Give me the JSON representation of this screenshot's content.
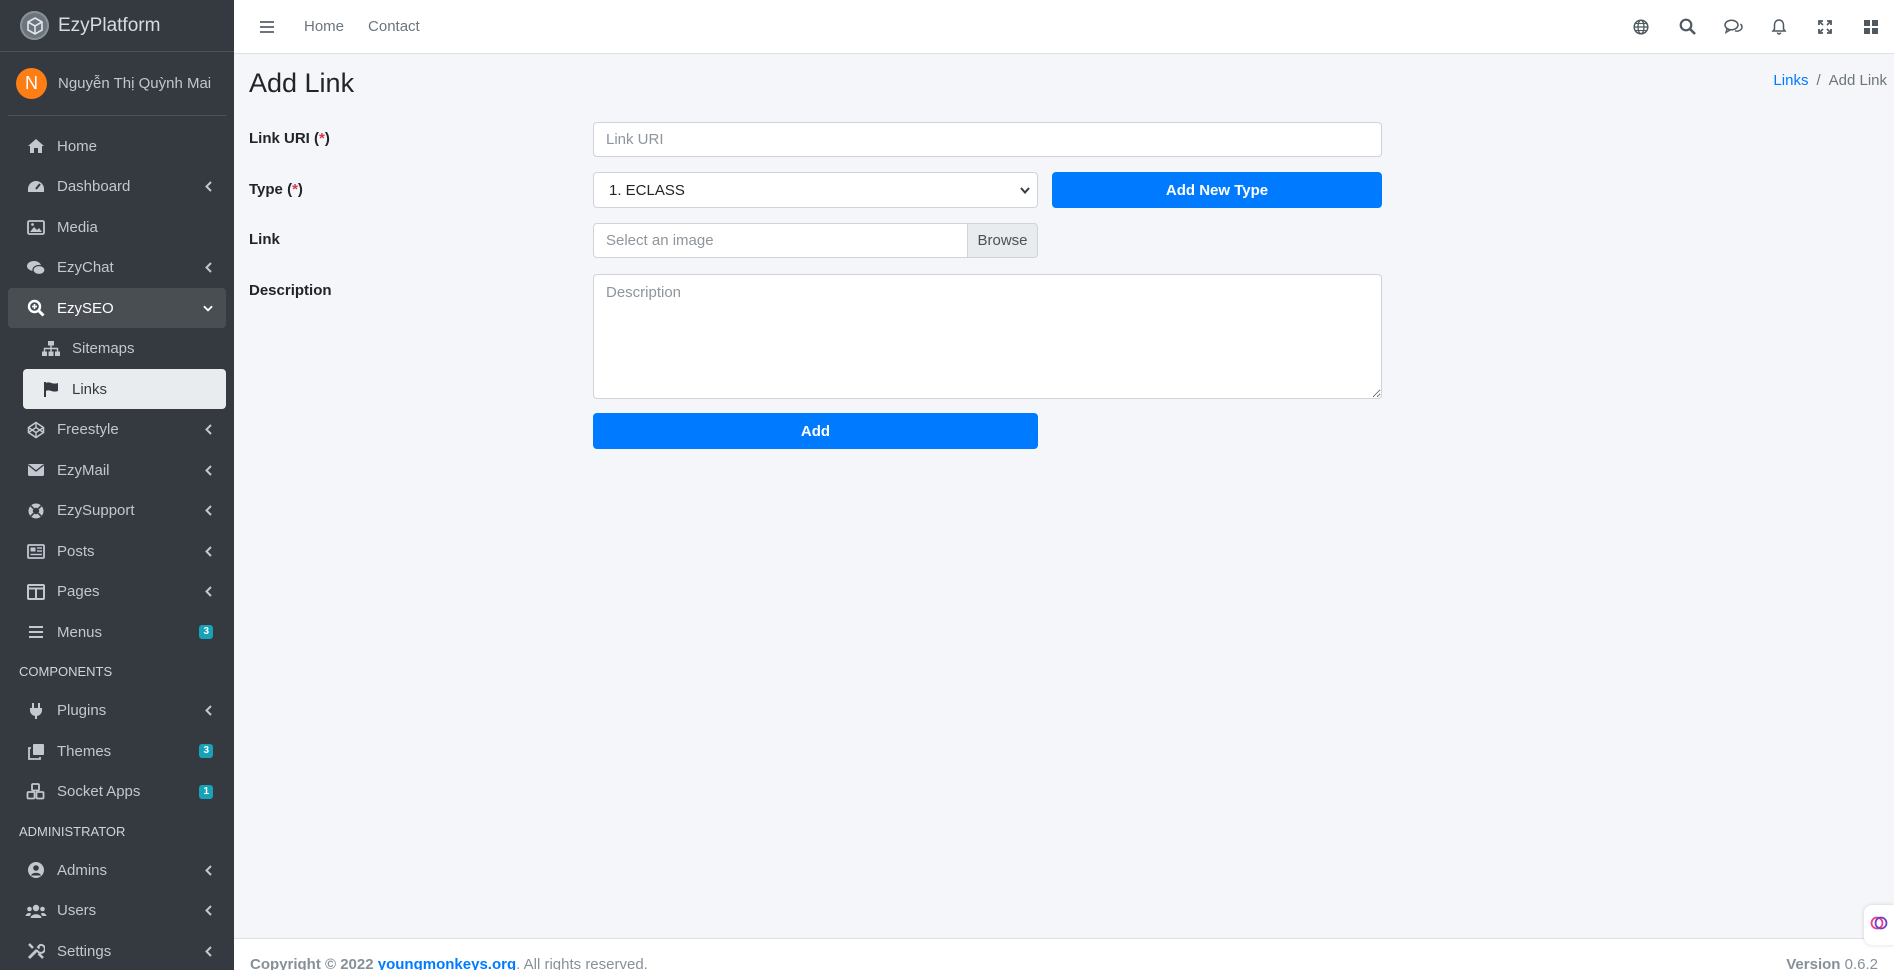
{
  "brand": {
    "name": "EzyPlatform"
  },
  "user": {
    "initial": "N",
    "name": "Nguyễn Thị Quỳnh Mai"
  },
  "sidebar": {
    "items": [
      {
        "label": "Home",
        "icon": "home-icon"
      },
      {
        "label": "Dashboard",
        "icon": "tachometer-icon"
      },
      {
        "label": "Media",
        "icon": "image-icon"
      },
      {
        "label": "EzyChat",
        "icon": "comments-icon"
      },
      {
        "label": "EzySEO",
        "icon": "search-plus-icon"
      },
      {
        "label": "Sitemaps",
        "icon": "sitemap-icon"
      },
      {
        "label": "Links",
        "icon": "flag-icon"
      },
      {
        "label": "Freestyle",
        "icon": "codepen-icon"
      },
      {
        "label": "EzyMail",
        "icon": "envelope-icon"
      },
      {
        "label": "EzySupport",
        "icon": "life-ring-icon"
      },
      {
        "label": "Posts",
        "icon": "newspaper-icon"
      },
      {
        "label": "Pages",
        "icon": "columns-icon"
      },
      {
        "label": "Menus",
        "icon": "bars-icon",
        "badge": "3"
      }
    ],
    "components_header": "COMPONENTS",
    "components": [
      {
        "label": "Plugins",
        "icon": "plug-icon"
      },
      {
        "label": "Themes",
        "icon": "clone-icon",
        "badge": "3"
      },
      {
        "label": "Socket Apps",
        "icon": "cubes-icon",
        "badge": "1"
      }
    ],
    "admin_header": "ADMINISTRATOR",
    "admin": [
      {
        "label": "Admins",
        "icon": "user-circle-icon"
      },
      {
        "label": "Users",
        "icon": "users-icon"
      },
      {
        "label": "Settings",
        "icon": "tools-icon"
      }
    ]
  },
  "topbar": {
    "links": [
      "Home",
      "Contact"
    ],
    "icons": [
      "globe-icon",
      "search-icon",
      "comments-icon",
      "bell-icon",
      "expand-icon",
      "grid-icon"
    ]
  },
  "page": {
    "title": "Add Link",
    "breadcrumb": {
      "link": "Links",
      "separator": "/",
      "current": "Add Link"
    }
  },
  "form": {
    "link_uri": {
      "label": "Link URI",
      "req_open": "(",
      "req_mark": "*",
      "req_close": ")",
      "placeholder": "Link URI",
      "value": ""
    },
    "type": {
      "label": "Type",
      "req_open": "(",
      "req_mark": "*",
      "req_close": ")",
      "selected": "1. ECLASS",
      "add_button": "Add New Type"
    },
    "link": {
      "label": "Link",
      "placeholder": "Select an image",
      "browse": "Browse"
    },
    "description": {
      "label": "Description",
      "placeholder": "Description",
      "value": ""
    },
    "submit": "Add"
  },
  "footer": {
    "copyright_prefix": "Copyright © 2022",
    "link": "youngmonkeys.org",
    "suffix": ". All rights reserved.",
    "version_label": "Version",
    "version": "0.6.2"
  },
  "colors": {
    "primary": "#007bff",
    "sidebar": "#343a40",
    "badge": "#17a2b8",
    "avatar": "#fd7e14"
  }
}
